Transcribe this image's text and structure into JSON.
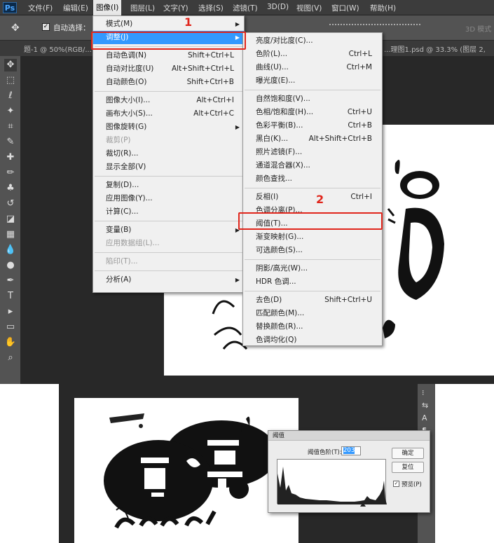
{
  "app": {
    "logo": "Ps"
  },
  "menubar": [
    "文件(F)",
    "编辑(E)",
    "图像(I)",
    "图层(L)",
    "文字(Y)",
    "选择(S)",
    "滤镜(T)",
    "3D(D)",
    "视图(V)",
    "窗口(W)",
    "帮助(H)"
  ],
  "options": {
    "auto_select_label": "自动选择：",
    "mode3d": "3D 模式"
  },
  "tabs": {
    "left": "题-1 @ 50%(RGB/...",
    "right": "...理图1.psd @ 33.3% (图层 2, ..."
  },
  "image_menu": [
    {
      "label": "模式(M)",
      "arrow": true
    },
    {
      "label": "调整(J)",
      "arrow": true,
      "highlight": true
    },
    {
      "sep": true
    },
    {
      "label": "自动色调(N)",
      "shortcut": "Shift+Ctrl+L"
    },
    {
      "label": "自动对比度(U)",
      "shortcut": "Alt+Shift+Ctrl+L"
    },
    {
      "label": "自动颜色(O)",
      "shortcut": "Shift+Ctrl+B"
    },
    {
      "sep": true
    },
    {
      "label": "图像大小(I)...",
      "shortcut": "Alt+Ctrl+I"
    },
    {
      "label": "画布大小(S)...",
      "shortcut": "Alt+Ctrl+C"
    },
    {
      "label": "图像旋转(G)",
      "arrow": true
    },
    {
      "label": "裁剪(P)",
      "disabled": true
    },
    {
      "label": "裁切(R)..."
    },
    {
      "label": "显示全部(V)"
    },
    {
      "sep": true
    },
    {
      "label": "复制(D)..."
    },
    {
      "label": "应用图像(Y)..."
    },
    {
      "label": "计算(C)..."
    },
    {
      "sep": true
    },
    {
      "label": "变量(B)",
      "arrow": true
    },
    {
      "label": "应用数据组(L)...",
      "disabled": true
    },
    {
      "sep": true
    },
    {
      "label": "陷印(T)...",
      "disabled": true
    },
    {
      "sep": true
    },
    {
      "label": "分析(A)",
      "arrow": true
    }
  ],
  "adjust_menu": [
    {
      "label": "亮度/对比度(C)..."
    },
    {
      "label": "色阶(L)...",
      "shortcut": "Ctrl+L"
    },
    {
      "label": "曲线(U)...",
      "shortcut": "Ctrl+M"
    },
    {
      "label": "曝光度(E)..."
    },
    {
      "sep": true
    },
    {
      "label": "自然饱和度(V)..."
    },
    {
      "label": "色相/饱和度(H)...",
      "shortcut": "Ctrl+U"
    },
    {
      "label": "色彩平衡(B)...",
      "shortcut": "Ctrl+B"
    },
    {
      "label": "黑白(K)...",
      "shortcut": "Alt+Shift+Ctrl+B"
    },
    {
      "label": "照片滤镜(F)..."
    },
    {
      "label": "通道混合器(X)..."
    },
    {
      "label": "颜色查找..."
    },
    {
      "sep": true
    },
    {
      "label": "反相(I)",
      "shortcut": "Ctrl+I"
    },
    {
      "label": "色调分离(P)..."
    },
    {
      "label": "阈值(T)..."
    },
    {
      "label": "渐变映射(G)..."
    },
    {
      "label": "可选颜色(S)..."
    },
    {
      "sep": true
    },
    {
      "label": "阴影/高光(W)..."
    },
    {
      "label": "HDR 色调..."
    },
    {
      "sep": true
    },
    {
      "label": "去色(D)",
      "shortcut": "Shift+Ctrl+U"
    },
    {
      "label": "匹配颜色(M)..."
    },
    {
      "label": "替换颜色(R)..."
    },
    {
      "label": "色调均化(Q)"
    }
  ],
  "annotations": {
    "one": "1",
    "two": "2"
  },
  "dialog": {
    "title": "阈值",
    "field_label": "阈值色阶(T):",
    "value": "203",
    "ok": "确定",
    "reset": "复位",
    "preview": "预览(P)"
  },
  "colors": {
    "highlight": "#3399ff",
    "annotation_red": "#e0251b"
  }
}
